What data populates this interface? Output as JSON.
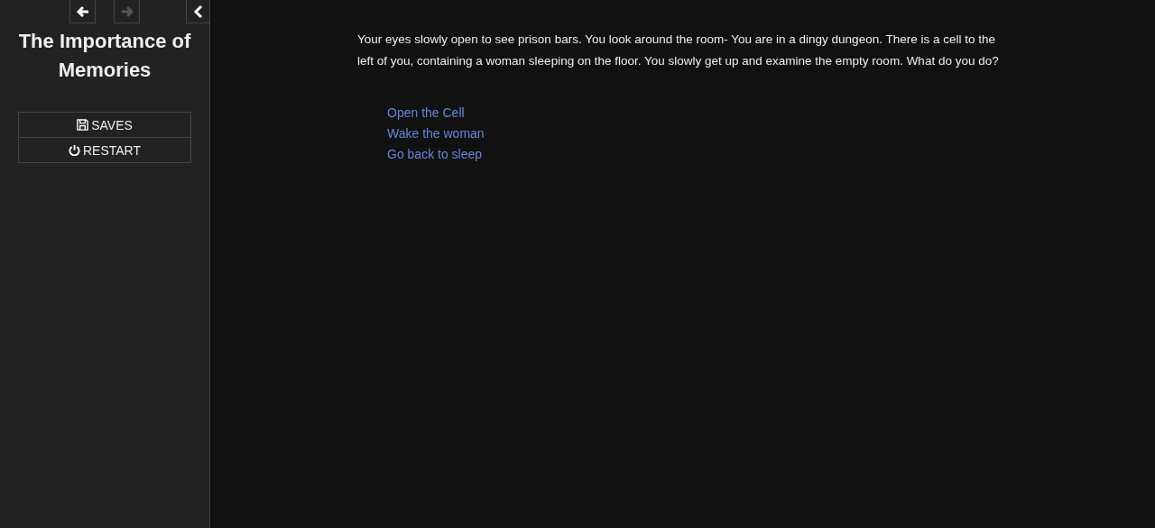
{
  "sidebar": {
    "history": [
      {
        "kind": "back",
        "disabled": false
      },
      {
        "kind": "forward",
        "disabled": true
      }
    ],
    "title": "The Importance of Memories",
    "menu": [
      {
        "kind": "saves",
        "label": "SAVES"
      },
      {
        "kind": "restart",
        "label": "RESTART"
      }
    ]
  },
  "passage": {
    "text": "Your eyes slowly open to see prison bars. You look around the room- You are in a dingy dungeon. There is a cell to the left of you, containing a woman sleeping on the floor. You slowly get up and examine the empty room. What do you do?",
    "links": [
      "Open the Cell",
      "Wake the woman",
      "Go back to sleep"
    ]
  }
}
